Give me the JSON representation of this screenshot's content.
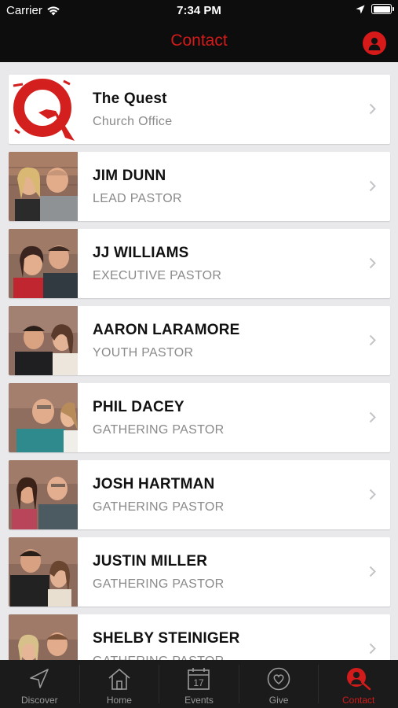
{
  "status_bar": {
    "carrier": "Carrier",
    "time": "7:34 PM"
  },
  "header": {
    "title": "Contact"
  },
  "colors": {
    "accent": "#d21b1b",
    "header_bg": "#0d0d0d",
    "tabbar_bg": "#1b1b1b"
  },
  "contacts": [
    {
      "name": "The Quest",
      "role": "Church Office",
      "image": "quest-logo"
    },
    {
      "name": "JIM DUNN",
      "role": "LEAD PASTOR",
      "image": "photo"
    },
    {
      "name": "JJ WILLIAMS",
      "role": "EXECUTIVE PASTOR",
      "image": "photo"
    },
    {
      "name": "AARON LARAMORE",
      "role": "YOUTH PASTOR",
      "image": "photo"
    },
    {
      "name": "PHIL DACEY",
      "role": "GATHERING PASTOR",
      "image": "photo"
    },
    {
      "name": "JOSH HARTMAN",
      "role": "GATHERING PASTOR",
      "image": "photo"
    },
    {
      "name": "JUSTIN MILLER",
      "role": "GATHERING PASTOR",
      "image": "photo"
    },
    {
      "name": "SHELBY STEINIGER",
      "role": "GATHERING PASTOR",
      "image": "photo"
    }
  ],
  "tabs": [
    {
      "label": "Discover",
      "icon": "navigation-arrow-icon",
      "active": false
    },
    {
      "label": "Home",
      "icon": "home-icon",
      "active": false
    },
    {
      "label": "Events",
      "icon": "calendar-icon",
      "calendar_day": "17",
      "active": false
    },
    {
      "label": "Give",
      "icon": "heart-icon",
      "active": false
    },
    {
      "label": "Contact",
      "icon": "contact-search-icon",
      "active": true
    }
  ]
}
